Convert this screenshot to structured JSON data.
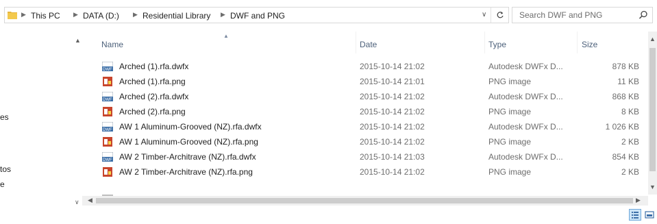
{
  "address_bar": {
    "breadcrumbs": [
      "This PC",
      "DATA (D:)",
      "Residential Library",
      "DWF and PNG"
    ]
  },
  "search": {
    "placeholder": "Search DWF and PNG"
  },
  "nav_pane": {
    "items": [
      "es",
      "tos",
      "e"
    ]
  },
  "columns": {
    "name": "Name",
    "date": "Date",
    "type": "Type",
    "size": "Size"
  },
  "files": [
    {
      "icon": "dwfx-file-icon",
      "name": "Arched (1).rfa.dwfx",
      "date": "2015-10-14 21:02",
      "type": "Autodesk DWFx D...",
      "size": "878 KB"
    },
    {
      "icon": "png-file-icon",
      "name": "Arched (1).rfa.png",
      "date": "2015-10-14 21:01",
      "type": "PNG image",
      "size": "11 KB"
    },
    {
      "icon": "dwfx-file-icon",
      "name": "Arched (2).rfa.dwfx",
      "date": "2015-10-14 21:02",
      "type": "Autodesk DWFx D...",
      "size": "868 KB"
    },
    {
      "icon": "png-file-icon",
      "name": "Arched (2).rfa.png",
      "date": "2015-10-14 21:02",
      "type": "PNG image",
      "size": "8 KB"
    },
    {
      "icon": "dwfx-file-icon",
      "name": "AW 1 Aluminum-Grooved (NZ).rfa.dwfx",
      "date": "2015-10-14 21:02",
      "type": "Autodesk DWFx D...",
      "size": "1 026 KB"
    },
    {
      "icon": "png-file-icon",
      "name": "AW 1 Aluminum-Grooved (NZ).rfa.png",
      "date": "2015-10-14 21:02",
      "type": "PNG image",
      "size": "2 KB"
    },
    {
      "icon": "dwfx-file-icon",
      "name": "AW 2 Timber-Architrave (NZ).rfa.dwfx",
      "date": "2015-10-14 21:03",
      "type": "Autodesk DWFx D...",
      "size": "854 KB"
    },
    {
      "icon": "png-file-icon",
      "name": "AW 2 Timber-Architrave (NZ).rfa.png",
      "date": "2015-10-14 21:02",
      "type": "PNG image",
      "size": "2 KB"
    }
  ],
  "colors": {
    "header_text": "#4c607a",
    "selected_view_bg": "#cce4f7",
    "selected_view_border": "#6fa9dc"
  }
}
